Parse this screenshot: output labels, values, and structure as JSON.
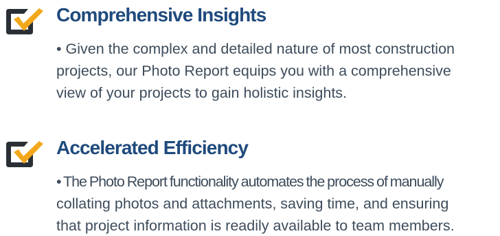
{
  "colors": {
    "heading": "#1f4a7c",
    "body_text": "#3d4c5b",
    "checkbox_frame": "#2a2f35",
    "checkmark": "#f3a81c"
  },
  "features": [
    {
      "icon": "checkbox-checked-icon",
      "title": "Comprehensive Insights",
      "lines": [
        "• Given the complex and detailed nature of most construction",
        "projects, our Photo Report equips you with a comprehensive",
        "view of your projects to gain holistic insights."
      ]
    },
    {
      "icon": "checkbox-checked-icon",
      "title": "Accelerated Efficiency",
      "lines": [
        "• The Photo Report functionality automates the process of manually",
        "collating photos and attachments, saving time, and ensuring",
        "that project information is readily available to team members."
      ]
    }
  ]
}
